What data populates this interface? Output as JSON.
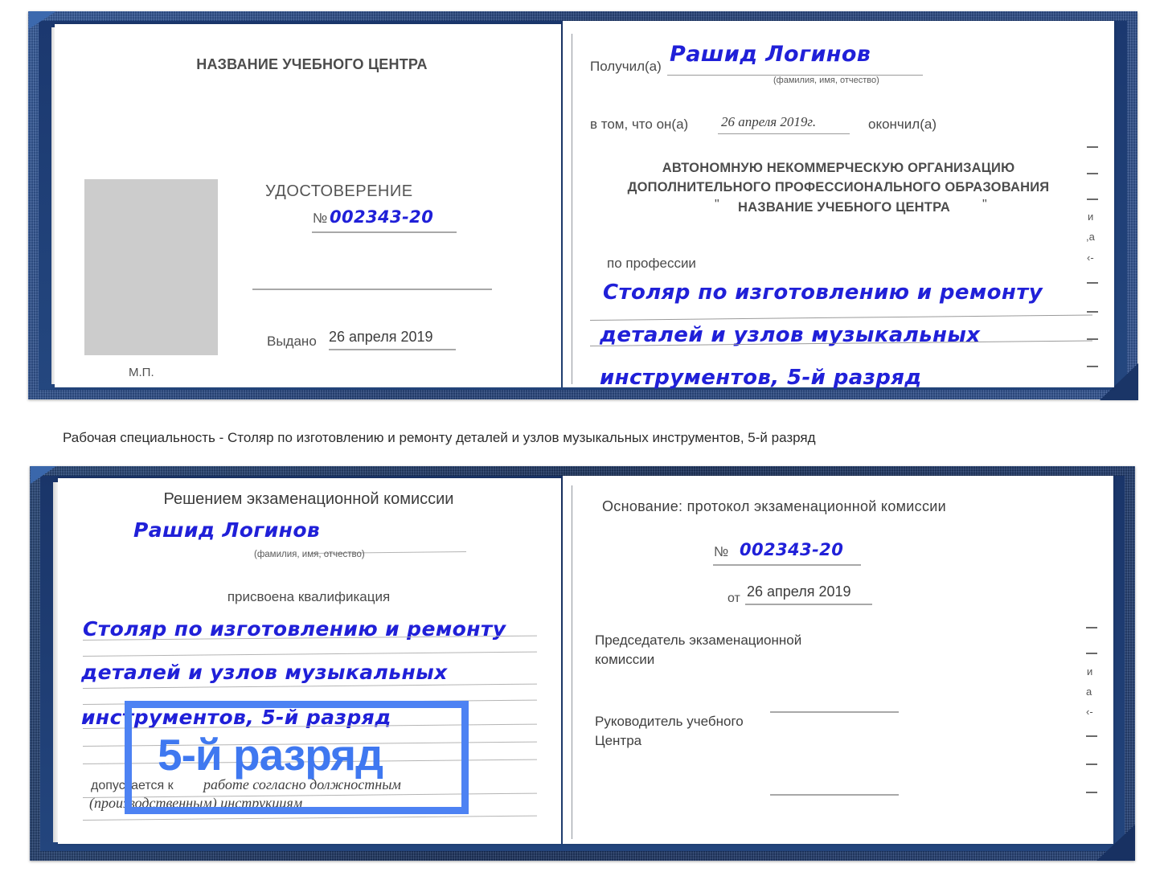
{
  "document_top": {
    "left_page": {
      "center_name": "НАЗВАНИЕ УЧЕБНОГО ЦЕНТРА",
      "title": "УДОСТОВЕРЕНИЕ",
      "number_symbol": "№",
      "number_value": "002343-20",
      "issued_label": "Выдано",
      "issued_value": "26 апреля 2019",
      "stamp_label": "М.П."
    },
    "right_page": {
      "received_label": "Получил(а)",
      "received_value": "Рашид Логинов",
      "received_hint": "(фамилия, имя, отчество)",
      "in_that_label": "в том, что он(а)",
      "in_that_value": "26 апреля 2019г.",
      "finished_label": "окончил(а)",
      "org_line1": "АВТОНОМНУЮ НЕКОММЕРЧЕСКУЮ ОРГАНИЗАЦИЮ",
      "org_line2": "ДОПОЛНИТЕЛЬНОГО ПРОФЕССИОНАЛЬНОГО ОБРАЗОВАНИЯ",
      "org_quote_open": "\"",
      "org_line3": "НАЗВАНИЕ УЧЕБНОГО ЦЕНТРА",
      "org_quote_close": "\"",
      "profession_label": "по профессии",
      "profession_line1": "Столяр по изготовлению и ремонту",
      "profession_line2": "деталей и узлов музыкальных",
      "profession_line3": "инструментов, 5-й разряд",
      "edge_fragments": [
        "и",
        ",а",
        "‹-"
      ]
    }
  },
  "caption": {
    "text": "Рабочая специальность - Столяр по изготовлению и ремонту деталей и узлов музыкальных инструментов, 5-й разряд"
  },
  "document_bottom": {
    "left_page": {
      "heading": "Решением экзаменационной комиссии",
      "name_value": "Рашид Логинов",
      "name_hint": "(фамилия, имя, отчество)",
      "qualification_label": "присвоена квалификация",
      "qual_line1": "Столяр по изготовлению и ремонту",
      "qual_line2": "деталей и узлов музыкальных",
      "qual_line3": "инструментов, 5-й разряд",
      "allowed_label": "допускается к",
      "allowed_value_line1": "работе согласно должностным",
      "allowed_value_line2": "(производственным) инструкциям"
    },
    "right_page": {
      "basis_label": "Основание: протокол экзаменационной комиссии",
      "number_symbol": "№",
      "number_value": "002343-20",
      "date_label": "от",
      "date_value": "26 апреля 2019",
      "chairman_line1": "Председатель экзаменационной",
      "chairman_line2": "комиссии",
      "head_line1": "Руководитель учебного",
      "head_line2": "Центра",
      "edge_fragments": [
        "и",
        "а",
        "‹-"
      ]
    }
  },
  "highlight": {
    "overlay_text": "5-й разряд",
    "box_color": "#4d82f3",
    "text_color": "#3f78f0"
  },
  "colors": {
    "cover_blue": "#244a8c",
    "handwriting_blue": "#2020d8",
    "page_white": "#ffffff",
    "photo_gray": "#cccccc"
  }
}
